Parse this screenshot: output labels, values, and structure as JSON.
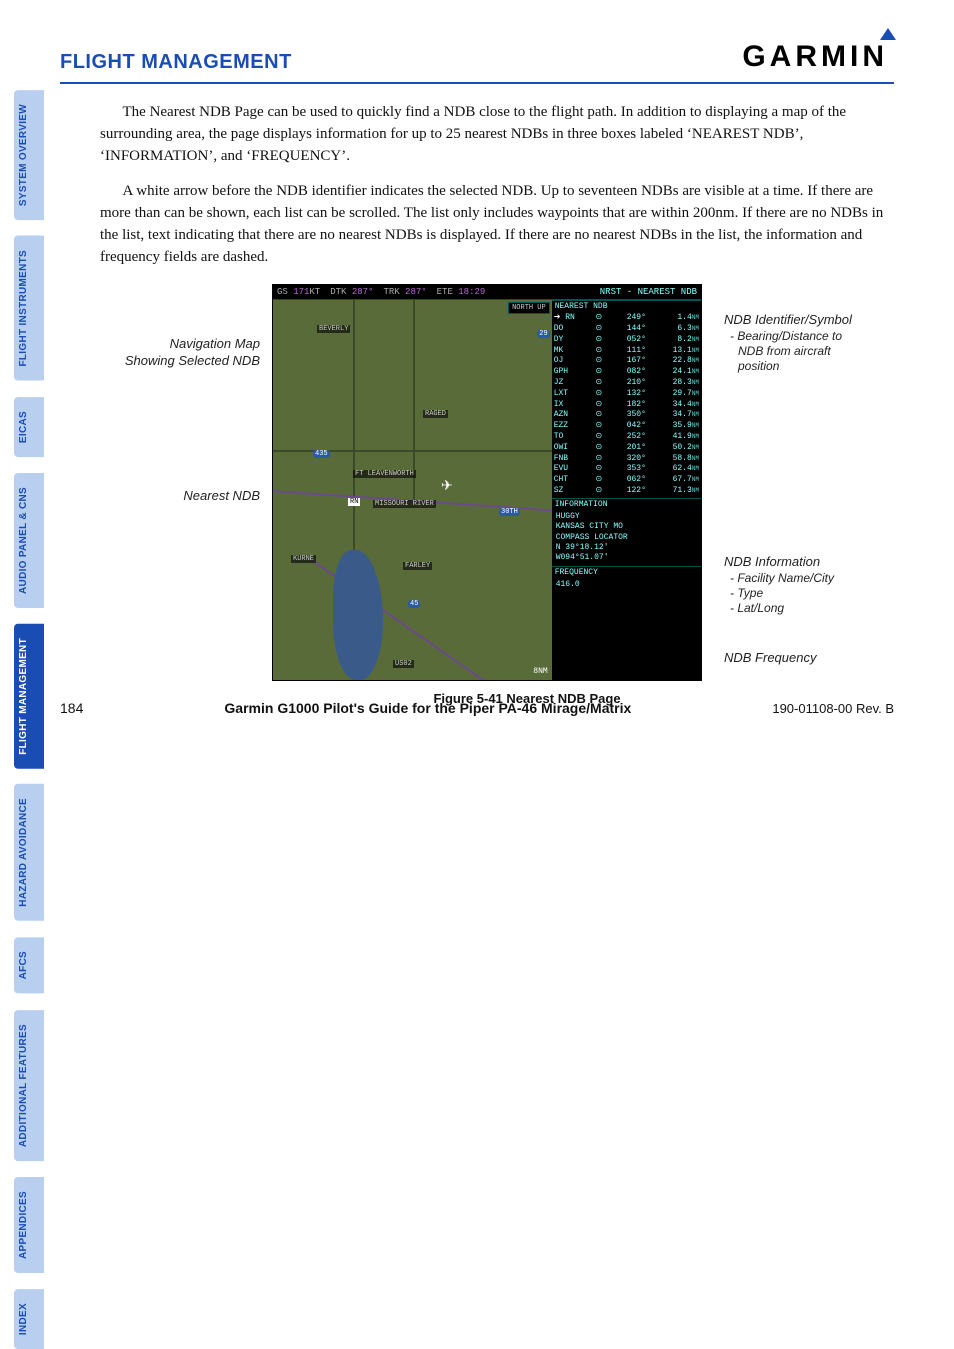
{
  "header": {
    "section": "FLIGHT MANAGEMENT",
    "brand": "GARMIN"
  },
  "sidebar": [
    {
      "label": "SYSTEM OVERVIEW",
      "active": false
    },
    {
      "label": "FLIGHT INSTRUMENTS",
      "active": false
    },
    {
      "label": "EICAS",
      "active": false
    },
    {
      "label": "AUDIO PANEL & CNS",
      "active": false
    },
    {
      "label": "FLIGHT MANAGEMENT",
      "active": true
    },
    {
      "label": "HAZARD AVOIDANCE",
      "active": false
    },
    {
      "label": "AFCS",
      "active": false
    },
    {
      "label": "ADDITIONAL FEATURES",
      "active": false
    },
    {
      "label": "APPENDICES",
      "active": false
    },
    {
      "label": "INDEX",
      "active": false
    }
  ],
  "paragraphs": [
    "The Nearest NDB Page can be used to quickly find a NDB close to the flight path.  In addition to displaying a map of the surrounding area, the page displays information for up to 25 nearest NDBs in three boxes labeled ‘NEAREST NDB’, ‘INFORMATION’, and ‘FREQUENCY’.",
    "A white arrow before the NDB identifier indicates the selected NDB.  Up to seventeen NDBs are visible at a time.  If there are more than can be shown, each list can be scrolled.  The list only includes waypoints that are within 200nm.  If there are no NDBs in the list, text indicating that there are no nearest NDBs is displayed.  If there are no nearest NDBs in the list, the information and frequency fields are dashed."
  ],
  "figure": {
    "topbar": {
      "gs": "171",
      "gs_unit": "KT",
      "dtk": "287°",
      "trk": "287°",
      "ete": "18:29",
      "page": "NRST - NEAREST NDB"
    },
    "northup": "NORTH UP",
    "scale": "8NM",
    "boxes": {
      "nearest": "NEAREST NDB",
      "info": "INFORMATION",
      "freq": "FREQUENCY"
    },
    "ndbs": [
      {
        "id": "RN",
        "brg": "249°",
        "dst": "1.4",
        "sel": true
      },
      {
        "id": "DO",
        "brg": "144°",
        "dst": "6.3"
      },
      {
        "id": "DY",
        "brg": "052°",
        "dst": "8.2"
      },
      {
        "id": "MK",
        "brg": "111°",
        "dst": "13.1"
      },
      {
        "id": "OJ",
        "brg": "167°",
        "dst": "22.8"
      },
      {
        "id": "GPH",
        "brg": "082°",
        "dst": "24.1"
      },
      {
        "id": "JZ",
        "brg": "210°",
        "dst": "28.3"
      },
      {
        "id": "LXT",
        "brg": "132°",
        "dst": "29.7"
      },
      {
        "id": "IX",
        "brg": "182°",
        "dst": "34.4"
      },
      {
        "id": "AZN",
        "brg": "350°",
        "dst": "34.7"
      },
      {
        "id": "EZZ",
        "brg": "042°",
        "dst": "35.9"
      },
      {
        "id": "TO",
        "brg": "252°",
        "dst": "41.9"
      },
      {
        "id": "OWI",
        "brg": "201°",
        "dst": "50.2"
      },
      {
        "id": "FNB",
        "brg": "320°",
        "dst": "58.8"
      },
      {
        "id": "EVU",
        "brg": "353°",
        "dst": "62.4"
      },
      {
        "id": "CHT",
        "brg": "062°",
        "dst": "67.7"
      },
      {
        "id": "SZ",
        "brg": "122°",
        "dst": "71.3"
      }
    ],
    "info": {
      "name": "HUGGY",
      "city": "KANSAS CITY MO",
      "type": "COMPASS LOCATOR",
      "lat": "N 39°18.12'",
      "lon": "W094°51.07'"
    },
    "frequency": "416.0",
    "map_labels": {
      "beverly": "BEVERLY",
      "raged": "RAGED",
      "leavenworth": "FT LEAVENWORTH",
      "river": "MISSOURI RIVER",
      "kurne": "KURNE",
      "farley": "FARLEY",
      "us02": "US02",
      "rn": "RN",
      "i29": "29",
      "i435": "435",
      "rt45": "45",
      "rt30th": "30TH"
    },
    "leftcallouts": {
      "map": "Navigation Map Showing Selected NDB",
      "nearest": "Nearest NDB"
    },
    "rightcallouts": {
      "id": "NDB Identifier/Symbol",
      "id_sub1": "- Bearing/Distance to",
      "id_sub2": "NDB from aircraft",
      "id_sub3": "position",
      "info": "NDB Information",
      "info_sub1": "- Facility Name/City",
      "info_sub2": "- Type",
      "info_sub3": "- Lat/Long",
      "freq": "NDB Frequency"
    },
    "caption": "Figure 5-41  Nearest NDB Page"
  },
  "footer": {
    "page": "184",
    "title": "Garmin G1000 Pilot's Guide for the Piper PA-46 Mirage/Matrix",
    "rev": "190-01108-00  Rev. B"
  }
}
